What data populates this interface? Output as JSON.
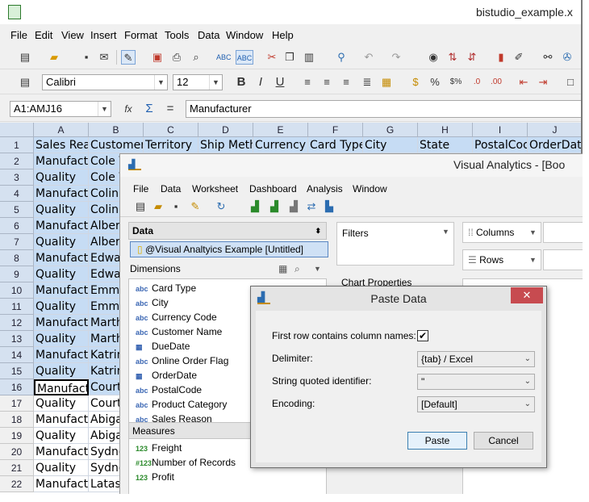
{
  "calc": {
    "window_title": "bistudio_example.x",
    "menu": [
      "File",
      "Edit",
      "View",
      "Insert",
      "Format",
      "Tools",
      "Data",
      "Window",
      "Help"
    ],
    "font_name": "Calibri",
    "font_size": "12",
    "name_box": "A1:AMJ16",
    "formula_content": "Manufacturer",
    "columns": [
      "A",
      "B",
      "C",
      "D",
      "E",
      "F",
      "G",
      "H",
      "I",
      "J"
    ],
    "header_row": [
      "Sales Rea",
      "Customer",
      "Territory",
      "Ship Meth",
      "Currency",
      "Card Type",
      "City",
      "State",
      "PostalCod",
      "OrderDat"
    ],
    "rows": [
      {
        "num": "1"
      },
      {
        "num": "2",
        "a": "Manufact",
        "b": "Cole V"
      },
      {
        "num": "3",
        "a": "Quality",
        "b": "Cole V"
      },
      {
        "num": "4",
        "a": "Manufact",
        "b": "Colin"
      },
      {
        "num": "5",
        "a": "Quality",
        "b": "Colin"
      },
      {
        "num": "6",
        "a": "Manufact",
        "b": "Albert"
      },
      {
        "num": "7",
        "a": "Quality",
        "b": "Albert"
      },
      {
        "num": "8",
        "a": "Manufact",
        "b": "Edwar"
      },
      {
        "num": "9",
        "a": "Quality",
        "b": "Edwar"
      },
      {
        "num": "10",
        "a": "Manufact",
        "b": "Emma"
      },
      {
        "num": "11",
        "a": "Quality",
        "b": "Emma"
      },
      {
        "num": "12",
        "a": "Manufact",
        "b": "Marth"
      },
      {
        "num": "13",
        "a": "Quality",
        "b": "Marth"
      },
      {
        "num": "14",
        "a": "Manufact",
        "b": "Katrin"
      },
      {
        "num": "15",
        "a": "Quality",
        "b": "Katrin"
      },
      {
        "num": "16",
        "a": "Manufact",
        "b": "Courtn"
      },
      {
        "num": "17",
        "a": "Quality",
        "b": "Courtn"
      },
      {
        "num": "18",
        "a": "Manufact",
        "b": "Abiga"
      },
      {
        "num": "19",
        "a": "Quality",
        "b": "Abiga"
      },
      {
        "num": "20",
        "a": "Manufact",
        "b": "Sydne"
      },
      {
        "num": "21",
        "a": "Quality",
        "b": "Sydne"
      },
      {
        "num": "22",
        "a": "Manufact",
        "b": "Latash"
      }
    ]
  },
  "va": {
    "window_title": "Visual Analytics - [Boo",
    "menu": [
      "File",
      "Data",
      "Worksheet",
      "Dashboard",
      "Analysis",
      "Window"
    ],
    "data_panel_title": "Data",
    "datasource": "@Visual Analtyics Example [Untitled]",
    "dimensions_title": "Dimensions",
    "dimensions": [
      {
        "type": "abc",
        "label": "Card Type"
      },
      {
        "type": "abc",
        "label": "City"
      },
      {
        "type": "abc",
        "label": "Currency Code"
      },
      {
        "type": "abc",
        "label": "Customer Name"
      },
      {
        "type": "date",
        "label": "DueDate"
      },
      {
        "type": "abc",
        "label": "Online Order Flag"
      },
      {
        "type": "date",
        "label": "OrderDate"
      },
      {
        "type": "abc",
        "label": "PostalCode"
      },
      {
        "type": "abc",
        "label": "Product Category"
      },
      {
        "type": "abc",
        "label": "Sales Reason"
      }
    ],
    "measures_title": "Measures",
    "measures": [
      {
        "type": "123",
        "label": "Freight"
      },
      {
        "type": "#123",
        "label": "Number of Records"
      },
      {
        "type": "123",
        "label": "Profit"
      }
    ],
    "filters_label": "Filters",
    "columns_label": "Columns",
    "rows_label": "Rows",
    "chart_properties_label": "Chart Properties"
  },
  "dialog": {
    "title": "Paste Data",
    "close_glyph": "✕",
    "first_row_label": "First row contains column names:",
    "first_row_checked": "✔",
    "delimiter_label": "Delimiter:",
    "delimiter_value": "{tab} / Excel",
    "quote_label": "String quoted identifier:",
    "quote_value": "\"",
    "encoding_label": "Encoding:",
    "encoding_value": "[Default]",
    "paste_button": "Paste",
    "cancel_button": "Cancel"
  }
}
